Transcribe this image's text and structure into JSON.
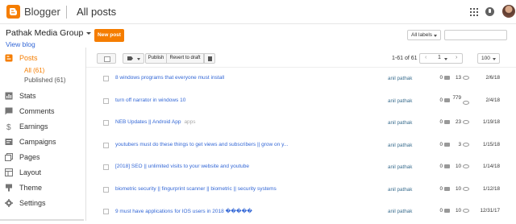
{
  "topbar": {
    "app_name": "Blogger",
    "page_title": "All posts"
  },
  "sidebar": {
    "blog_name": "Pathak Media Group",
    "view_blog": "View blog",
    "items": [
      {
        "label": "Posts",
        "icon": "posts-icon",
        "active": true
      },
      {
        "label": "Stats",
        "icon": "stats-icon"
      },
      {
        "label": "Comments",
        "icon": "comments-icon"
      },
      {
        "label": "Earnings",
        "icon": "earnings-icon"
      },
      {
        "label": "Campaigns",
        "icon": "campaigns-icon"
      },
      {
        "label": "Pages",
        "icon": "pages-icon"
      },
      {
        "label": "Layout",
        "icon": "layout-icon"
      },
      {
        "label": "Theme",
        "icon": "theme-icon"
      },
      {
        "label": "Settings",
        "icon": "settings-icon"
      }
    ],
    "subitems": [
      {
        "label": "All (61)",
        "active": true
      },
      {
        "label": "Published (61)"
      }
    ]
  },
  "actions": {
    "new_post": "New post",
    "labels_filter": "All labels",
    "publish": "Publish",
    "revert_to_draft": "Revert to draft"
  },
  "pagination": {
    "count_text": "1-61 of 61",
    "page": "1",
    "per_page": "100"
  },
  "posts": [
    {
      "title": "8 windows programs that everyone must install",
      "label": "",
      "author": "anil pathak",
      "comments": "0",
      "views": "13",
      "date": "2/6/18"
    },
    {
      "title": "turn off narrator in windows 10",
      "label": "",
      "author": "anil pathak",
      "comments": "0",
      "views": "779",
      "date": "2/4/18"
    },
    {
      "title": "NEB Updates || Android App",
      "label": "apps",
      "author": "anil pathak",
      "comments": "0",
      "views": "23",
      "date": "1/19/18"
    },
    {
      "title": "youtubers must do these things to get views and subscribers || grow on y...",
      "label": "",
      "author": "anil pathak",
      "comments": "0",
      "views": "3",
      "date": "1/15/18"
    },
    {
      "title": "[2018] SEO || unlimited visits to your website and youtube",
      "label": "",
      "author": "anil pathak",
      "comments": "0",
      "views": "10",
      "date": "1/14/18"
    },
    {
      "title": "biometric security || fingurprint scanner || biometric || security systems",
      "label": "",
      "author": "anil pathak",
      "comments": "0",
      "views": "10",
      "date": "1/12/18"
    },
    {
      "title": "9 must have applications for IOS users in 2018 �����",
      "label": "",
      "author": "anil pathak",
      "comments": "0",
      "views": "10",
      "date": "12/31/17"
    }
  ],
  "colors": {
    "accent": "#f57d00",
    "link": "#3367d6"
  }
}
